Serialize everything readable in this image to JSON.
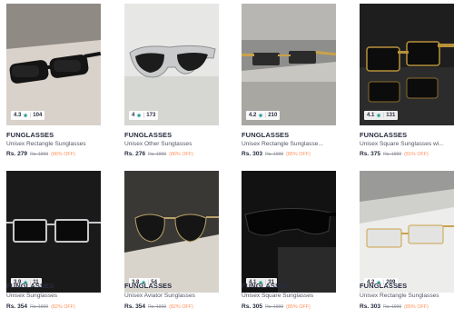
{
  "products": [
    {
      "brand": "FUNGLASSES",
      "name": "Unisex Rectangle Sunglasses",
      "price": "Rs. 279",
      "mrp": "Rs. 1999",
      "discount": "(86% OFF)",
      "rating": "4.3",
      "star": "★",
      "reviews": "104",
      "image": "black-rectangle-on-beige"
    },
    {
      "brand": "FUNGLASSES",
      "name": "Unisex Other Sunglasses",
      "price": "Rs. 276",
      "mrp": "Rs. 1999",
      "discount": "(86% OFF)",
      "rating": "4",
      "star": "★",
      "reviews": "173",
      "image": "silver-wrap-on-white"
    },
    {
      "brand": "FUNGLASSES",
      "name": "Unisex Rectangle Sunglasse...",
      "price": "Rs. 303",
      "mrp": "Rs. 1999",
      "discount": "(85% OFF)",
      "rating": "4.2",
      "star": "★",
      "reviews": "210",
      "image": "gold-rimless-on-stone"
    },
    {
      "brand": "FUNGLASSES",
      "name": "Unisex Square Sunglasses wi...",
      "price": "Rs. 375",
      "mrp": "Rs. 1999",
      "discount": "(81% OFF)",
      "rating": "4.1",
      "star": "★",
      "reviews": "131",
      "image": "black-gold-on-dark"
    },
    {
      "brand": "FUNGLASSES",
      "name": "Unisex Sunglasses",
      "price": "Rs. 354",
      "mrp": "Rs. 1999",
      "discount": "(82% OFF)",
      "rating": "3.9",
      "star": "★",
      "reviews": "11",
      "image": "silver-square-on-black"
    },
    {
      "brand": "FUNGLASSES",
      "name": "Unisex Aviator Sunglasses",
      "price": "Rs. 354",
      "mrp": "Rs. 1999",
      "discount": "(82% OFF)",
      "rating": "3.8",
      "star": "★",
      "reviews": "54",
      "image": "aviator-on-stone"
    },
    {
      "brand": "FUNGLASSES",
      "name": "Unisex Square Sunglasses",
      "price": "Rs. 305",
      "mrp": "Rs. 1999",
      "discount": "(85% OFF)",
      "rating": "4.1",
      "star": "★",
      "reviews": "31",
      "image": "black-shield-on-dark"
    },
    {
      "brand": "FUNGLASSES",
      "name": "Unisex Rectangle Sunglasses",
      "price": "Rs. 303",
      "mrp": "Rs. 1999",
      "discount": "(85% OFF)",
      "rating": "4.2",
      "star": "★",
      "reviews": "209",
      "image": "gold-rimless-on-white"
    }
  ],
  "colors": {
    "star": "#14958f",
    "discount": "#ff905a",
    "brand": "#282c3f",
    "muted": "#535766"
  }
}
